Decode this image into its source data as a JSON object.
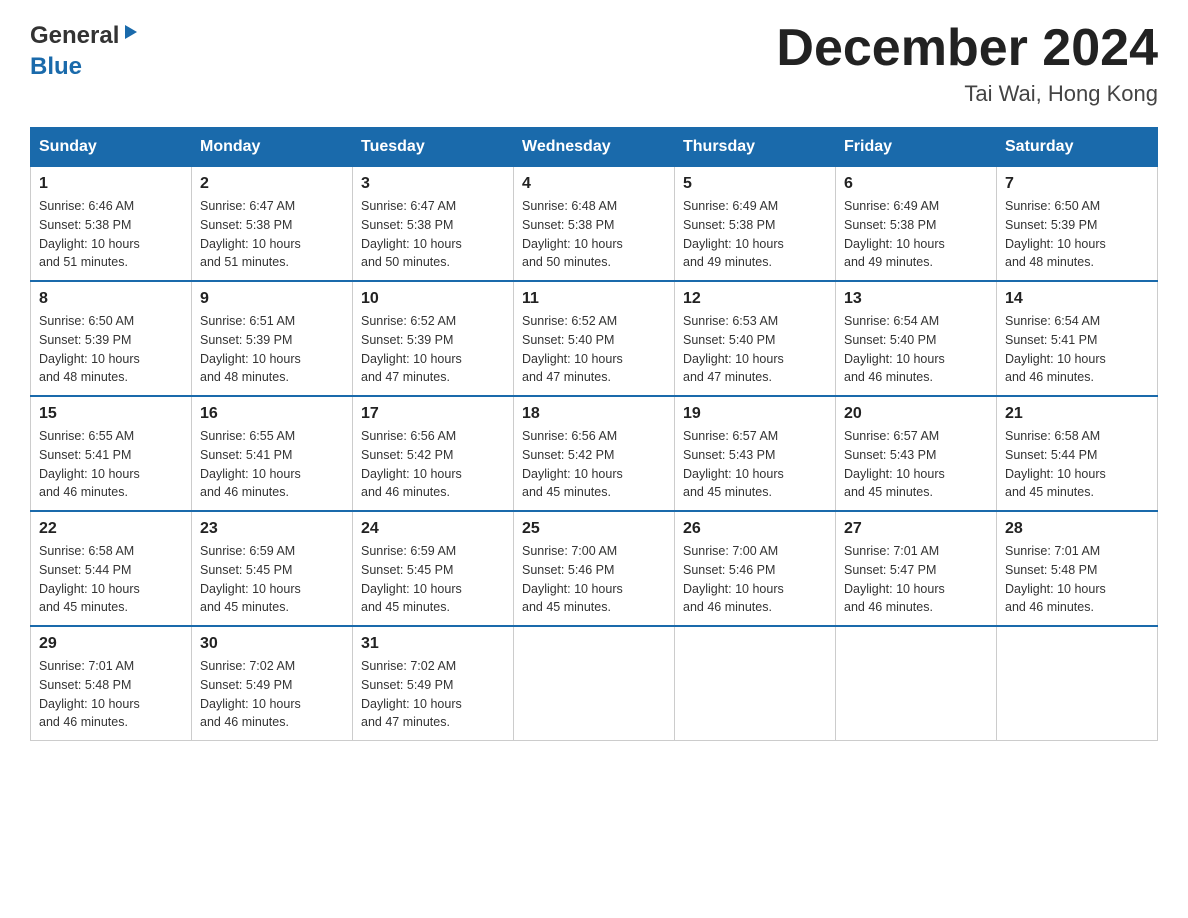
{
  "logo": {
    "general": "General",
    "blue": "Blue"
  },
  "header": {
    "title": "December 2024",
    "subtitle": "Tai Wai, Hong Kong"
  },
  "weekdays": [
    "Sunday",
    "Monday",
    "Tuesday",
    "Wednesday",
    "Thursday",
    "Friday",
    "Saturday"
  ],
  "weeks": [
    [
      {
        "day": "1",
        "sunrise": "6:46 AM",
        "sunset": "5:38 PM",
        "daylight": "10 hours and 51 minutes."
      },
      {
        "day": "2",
        "sunrise": "6:47 AM",
        "sunset": "5:38 PM",
        "daylight": "10 hours and 51 minutes."
      },
      {
        "day": "3",
        "sunrise": "6:47 AM",
        "sunset": "5:38 PM",
        "daylight": "10 hours and 50 minutes."
      },
      {
        "day": "4",
        "sunrise": "6:48 AM",
        "sunset": "5:38 PM",
        "daylight": "10 hours and 50 minutes."
      },
      {
        "day": "5",
        "sunrise": "6:49 AM",
        "sunset": "5:38 PM",
        "daylight": "10 hours and 49 minutes."
      },
      {
        "day": "6",
        "sunrise": "6:49 AM",
        "sunset": "5:38 PM",
        "daylight": "10 hours and 49 minutes."
      },
      {
        "day": "7",
        "sunrise": "6:50 AM",
        "sunset": "5:39 PM",
        "daylight": "10 hours and 48 minutes."
      }
    ],
    [
      {
        "day": "8",
        "sunrise": "6:50 AM",
        "sunset": "5:39 PM",
        "daylight": "10 hours and 48 minutes."
      },
      {
        "day": "9",
        "sunrise": "6:51 AM",
        "sunset": "5:39 PM",
        "daylight": "10 hours and 48 minutes."
      },
      {
        "day": "10",
        "sunrise": "6:52 AM",
        "sunset": "5:39 PM",
        "daylight": "10 hours and 47 minutes."
      },
      {
        "day": "11",
        "sunrise": "6:52 AM",
        "sunset": "5:40 PM",
        "daylight": "10 hours and 47 minutes."
      },
      {
        "day": "12",
        "sunrise": "6:53 AM",
        "sunset": "5:40 PM",
        "daylight": "10 hours and 47 minutes."
      },
      {
        "day": "13",
        "sunrise": "6:54 AM",
        "sunset": "5:40 PM",
        "daylight": "10 hours and 46 minutes."
      },
      {
        "day": "14",
        "sunrise": "6:54 AM",
        "sunset": "5:41 PM",
        "daylight": "10 hours and 46 minutes."
      }
    ],
    [
      {
        "day": "15",
        "sunrise": "6:55 AM",
        "sunset": "5:41 PM",
        "daylight": "10 hours and 46 minutes."
      },
      {
        "day": "16",
        "sunrise": "6:55 AM",
        "sunset": "5:41 PM",
        "daylight": "10 hours and 46 minutes."
      },
      {
        "day": "17",
        "sunrise": "6:56 AM",
        "sunset": "5:42 PM",
        "daylight": "10 hours and 46 minutes."
      },
      {
        "day": "18",
        "sunrise": "6:56 AM",
        "sunset": "5:42 PM",
        "daylight": "10 hours and 45 minutes."
      },
      {
        "day": "19",
        "sunrise": "6:57 AM",
        "sunset": "5:43 PM",
        "daylight": "10 hours and 45 minutes."
      },
      {
        "day": "20",
        "sunrise": "6:57 AM",
        "sunset": "5:43 PM",
        "daylight": "10 hours and 45 minutes."
      },
      {
        "day": "21",
        "sunrise": "6:58 AM",
        "sunset": "5:44 PM",
        "daylight": "10 hours and 45 minutes."
      }
    ],
    [
      {
        "day": "22",
        "sunrise": "6:58 AM",
        "sunset": "5:44 PM",
        "daylight": "10 hours and 45 minutes."
      },
      {
        "day": "23",
        "sunrise": "6:59 AM",
        "sunset": "5:45 PM",
        "daylight": "10 hours and 45 minutes."
      },
      {
        "day": "24",
        "sunrise": "6:59 AM",
        "sunset": "5:45 PM",
        "daylight": "10 hours and 45 minutes."
      },
      {
        "day": "25",
        "sunrise": "7:00 AM",
        "sunset": "5:46 PM",
        "daylight": "10 hours and 45 minutes."
      },
      {
        "day": "26",
        "sunrise": "7:00 AM",
        "sunset": "5:46 PM",
        "daylight": "10 hours and 46 minutes."
      },
      {
        "day": "27",
        "sunrise": "7:01 AM",
        "sunset": "5:47 PM",
        "daylight": "10 hours and 46 minutes."
      },
      {
        "day": "28",
        "sunrise": "7:01 AM",
        "sunset": "5:48 PM",
        "daylight": "10 hours and 46 minutes."
      }
    ],
    [
      {
        "day": "29",
        "sunrise": "7:01 AM",
        "sunset": "5:48 PM",
        "daylight": "10 hours and 46 minutes."
      },
      {
        "day": "30",
        "sunrise": "7:02 AM",
        "sunset": "5:49 PM",
        "daylight": "10 hours and 46 minutes."
      },
      {
        "day": "31",
        "sunrise": "7:02 AM",
        "sunset": "5:49 PM",
        "daylight": "10 hours and 47 minutes."
      },
      null,
      null,
      null,
      null
    ]
  ],
  "labels": {
    "sunrise": "Sunrise:",
    "sunset": "Sunset:",
    "daylight": "Daylight:"
  }
}
